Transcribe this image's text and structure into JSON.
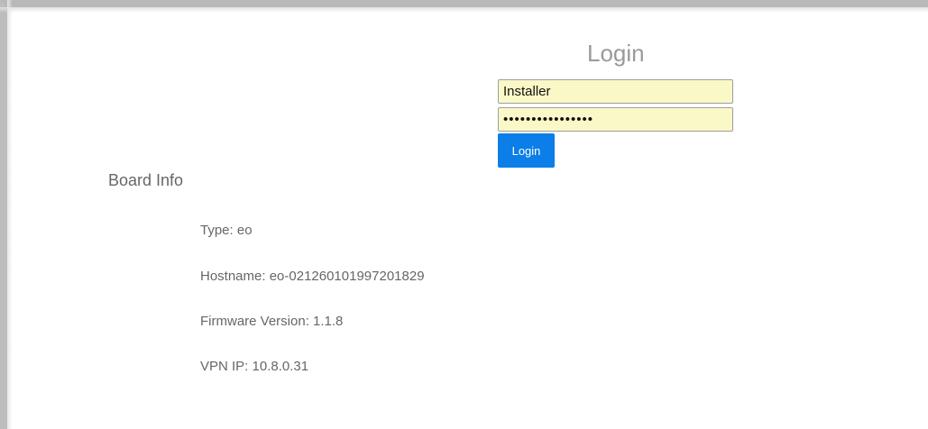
{
  "login": {
    "title": "Login",
    "username_value": "Installer",
    "password_value": "••••••••••••••••",
    "button_label": "Login"
  },
  "board_info": {
    "title": "Board Info",
    "rows": [
      "Type: eo",
      "Hostname: eo-021260101997201829",
      "Firmware Version: 1.1.8",
      "VPN IP: 10.8.0.31"
    ]
  }
}
